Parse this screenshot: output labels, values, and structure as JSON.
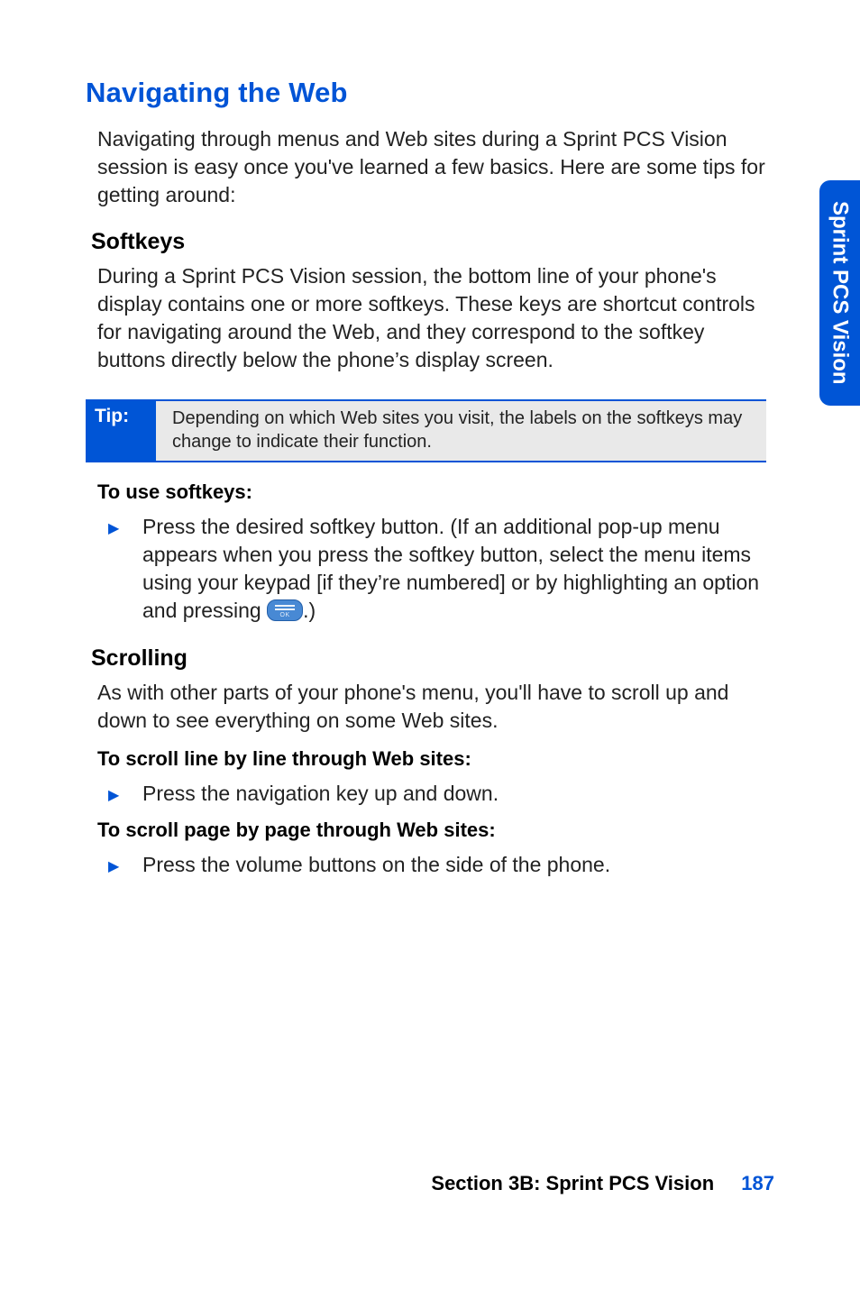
{
  "title": "Navigating the Web",
  "intro": "Navigating through menus and Web sites during a Sprint PCS Vision session is easy once you've learned a few basics. Here are some tips for getting around:",
  "softkeys": {
    "heading": "Softkeys",
    "body": "During a Sprint PCS Vision session, the bottom line of your phone's display contains one or more softkeys. These keys are shortcut controls for navigating around the Web, and they correspond to the softkey buttons directly below the phone’s display screen."
  },
  "tip": {
    "label": "Tip:",
    "text": "Depending on which Web sites you visit, the labels on the softkeys may change to indicate their function."
  },
  "toUseSoftkeys": {
    "label": "To use softkeys:",
    "bullet_before": "Press the desired softkey button. (If an additional pop-up menu appears when you press the softkey button, select the menu items using your keypad [if they’re numbered] or by highlighting an option and pressing ",
    "bullet_after": ".)"
  },
  "scrolling": {
    "heading": "Scrolling",
    "body": "As with other parts of your phone's menu, you'll have to scroll up and down to see everything on some Web sites.",
    "line_label": "To scroll line by line through Web sites:",
    "line_bullet": "Press the navigation key up and down.",
    "page_label": "To scroll page by page through Web sites:",
    "page_bullet": "Press the volume buttons on the side of the phone."
  },
  "side_tab": "Sprint PCS Vision",
  "footer": {
    "section": "Section 3B: Sprint PCS Vision",
    "page": "187"
  }
}
